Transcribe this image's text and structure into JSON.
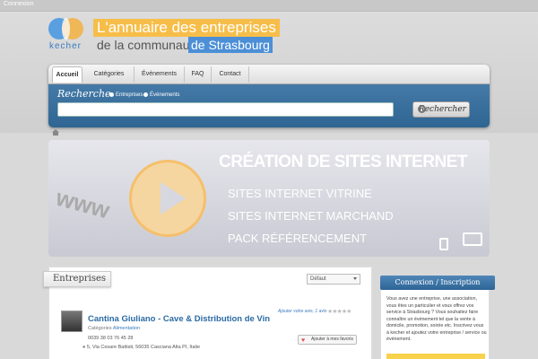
{
  "topbar": {
    "connexion": "Connexion"
  },
  "logo": {
    "name": "kecher"
  },
  "tagline": {
    "line1": "L'annuaire des entreprises",
    "line2": "de la communauté",
    "line3": "de Strasbourg"
  },
  "nav": {
    "tabs": [
      "Accueil",
      "Catégories",
      "Événements",
      "FAQ",
      "Contact"
    ],
    "active": "Accueil"
  },
  "search": {
    "label": "Recherche",
    "option1": "Entreprises",
    "option2": "Événements",
    "button": "Rechercher",
    "placeholder": ""
  },
  "banner": {
    "title": "CRÉATION DE SITES INTERNET",
    "lines": [
      "SITES INTERNET VITRINE",
      "SITES INTERNET MARCHAND",
      "PACK RÉFÉRENCEMENT"
    ],
    "www": "www"
  },
  "main": {
    "tab": "Entreprises",
    "sort": "Défaut",
    "listing": {
      "name": "Cantina Giuliano - Cave & Distribution de Vin",
      "category_prefix": "Catégories",
      "category": "Alimentation",
      "phone": "0039 38 03 76 45 28",
      "address": "5, Via Cesare Battisti, 56035 Casciana Alta PI, Italie",
      "vote": "Ajouter votre avis, 1 avis",
      "stars": "★★★★★",
      "favorite": "Ajouter à mes favoris"
    }
  },
  "sidebar": {
    "title": "Connexion / Inscription",
    "text": "Vous avez une entreprise, une association, vous êtes un particulier et vous offrez vos service à Strasbourg ? Vous souhaitez faire connaître un événement tel que la vente à domicile, promotion, soirée etc. Inscrivez vous à kecher et ajoutez votre entreprise / service ou événement."
  },
  "colors": {
    "accent_blue": "#3a7bbf",
    "nav_blue": "#2f6592",
    "tagline_orange": "#f6be49",
    "tagline_blue": "#4c8fd6"
  }
}
